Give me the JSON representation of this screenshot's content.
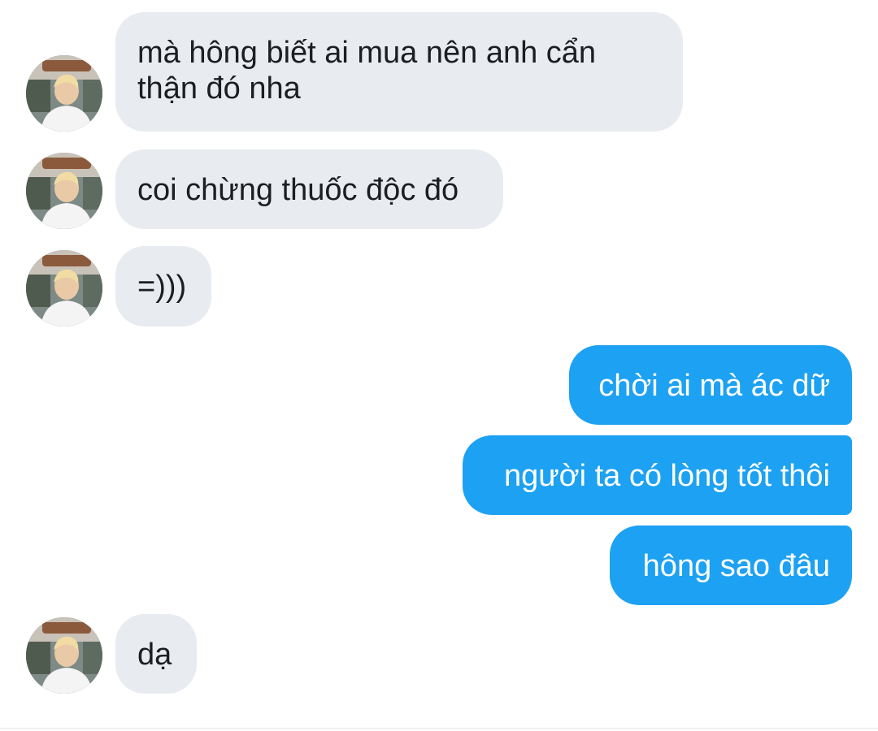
{
  "messages": [
    {
      "side": "in",
      "text": "mà hông biết ai mua nên anh cẩn thận đó nha"
    },
    {
      "side": "in",
      "text": "coi chừng thuốc độc đó"
    },
    {
      "side": "in",
      "text": "=)))"
    },
    {
      "side": "out",
      "text": "chời ai mà ác dữ"
    },
    {
      "side": "out",
      "text": "người ta có lòng tốt thôi"
    },
    {
      "side": "out",
      "text": "hông sao đâu"
    },
    {
      "side": "in",
      "text": "dạ"
    }
  ],
  "colors": {
    "incoming_bubble": "#e8ebef",
    "outgoing_bubble": "#1da1f2",
    "incoming_text": "#1c1e21",
    "outgoing_text": "#ffffff"
  },
  "icons": {
    "avatar": "contact-avatar-photo"
  }
}
